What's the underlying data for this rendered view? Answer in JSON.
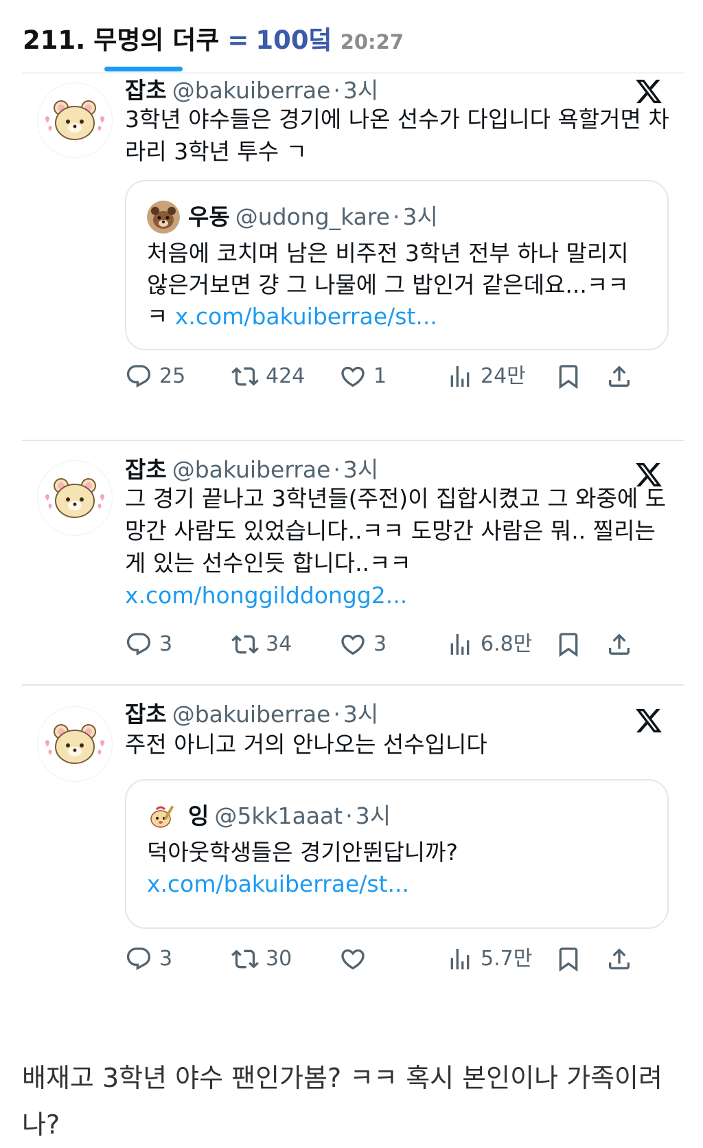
{
  "header": {
    "post_number": "211.",
    "title": "무명의 더쿠",
    "eq": "=",
    "count": "100덬",
    "time": "20:27"
  },
  "tweets": [
    {
      "name": "잡초",
      "handle": "@bakuiberrae",
      "dot": "·",
      "time": "3시",
      "text": "3학년 야수들은 경기에 나온 선수가 다입니다 욕할거면 차라리 3학년 투수 ㄱ",
      "quote": {
        "name": "우동",
        "handle": "@udong_kare",
        "dot": "·",
        "time": "3시",
        "text": "처음에 코치며 남은 비주전 3학년 전부 하나 말리지 않은거보면 걍 그 나물에 그 밥인거 같은데요...ㅋㅋ ㅋ ",
        "link": "x.com/bakuiberrae/st..."
      },
      "replies": "25",
      "retweets": "424",
      "likes": "1",
      "views": "24만"
    },
    {
      "name": "잡초",
      "handle": "@bakuiberrae",
      "dot": "·",
      "time": "3시",
      "text": "그 경기 끝나고 3학년들(주전)이 집합시켰고 그 와중에 도망간 사람도 있었습니다..ㅋㅋ 도망간 사람은 뭐.. 찔리는게 있는 선수인듯 합니다..ㅋㅋ ",
      "link": "x.com/honggilddongg2...",
      "replies": "3",
      "retweets": "34",
      "likes": "3",
      "views": "6.8만"
    },
    {
      "name": "잡초",
      "handle": "@bakuiberrae",
      "dot": "·",
      "time": "3시",
      "text": "주전 아니고 거의 안나오는 선수입니다",
      "quote": {
        "name": "잉",
        "handle": "@5kk1aaat",
        "dot": "·",
        "time": "3시",
        "text": "덕아웃학생들은 경기안뛴답니까? ",
        "link": "x.com/bakuiberrae/st..."
      },
      "replies": "3",
      "retweets": "30",
      "likes": "",
      "views": "5.7만"
    }
  ],
  "comment": "배재고 3학년 야수 팬인가봄? ㅋㅋ 혹시 본인이나 가족이려나?",
  "colors": {
    "accent": "#1d9bf0",
    "eq": "#3c5aa8",
    "gray": "#536471"
  }
}
